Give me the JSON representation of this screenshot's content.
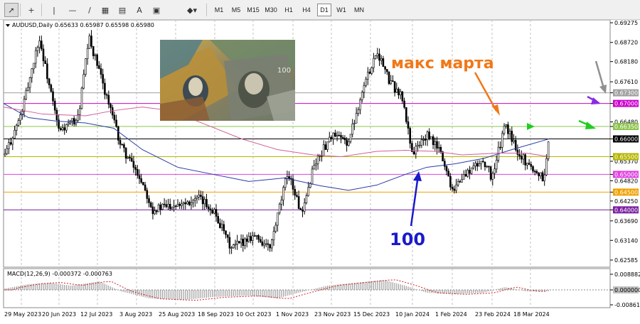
{
  "toolbar": {
    "tools": [
      {
        "name": "cursor-tool",
        "glyph": "➚"
      },
      {
        "name": "crosshair-tool",
        "glyph": "+"
      },
      {
        "name": "vertical-line-tool",
        "glyph": "|"
      },
      {
        "name": "horizontal-line-tool",
        "glyph": "—"
      },
      {
        "name": "trendline-tool",
        "glyph": "/"
      },
      {
        "name": "fibonacci-tool",
        "glyph": "▦"
      },
      {
        "name": "channel-tool",
        "glyph": "▤"
      },
      {
        "name": "text-tool",
        "glyph": "A"
      },
      {
        "name": "text-label-tool",
        "glyph": "▣"
      },
      {
        "name": "shapes-tool",
        "glyph": "◆▾"
      }
    ],
    "timeframes": [
      "M1",
      "M5",
      "M15",
      "M30",
      "H1",
      "H4",
      "D1",
      "W1",
      "MN"
    ],
    "active_timeframe": "D1"
  },
  "chart": {
    "symbol_header": "AUDUSD,Daily  0.65633 0.65987 0.65598 0.65980",
    "price_labels": [
      "0.69275",
      "0.68720",
      "0.68180",
      "0.67610",
      "0.67300",
      "0.67000",
      "0.66480",
      "0.66350",
      "0.66000",
      "0.65370",
      "0.65500",
      "0.65000",
      "0.64820",
      "0.64500",
      "0.64250",
      "0.64000",
      "0.63690",
      "0.63140",
      "0.62585"
    ],
    "highlighted_levels": [
      {
        "label": "0.67300",
        "color": "#a0a0a0"
      },
      {
        "label": "0.67000",
        "color": "#cc00cc"
      },
      {
        "label": "0.66350",
        "color": "#8bc34a"
      },
      {
        "label": "0.66000",
        "color": "#000000"
      },
      {
        "label": "0.65500",
        "color": "#b5b500"
      },
      {
        "label": "0.65000",
        "color": "#e040e0"
      },
      {
        "label": "0.64500",
        "color": "#f0a000"
      },
      {
        "label": "0.64000",
        "color": "#7b1fa2"
      }
    ],
    "date_labels": [
      "29 May 2023",
      "20 Jun 2023",
      "12 Jul 2023",
      "3 Aug 2023",
      "25 Aug 2023",
      "18 Sep 2023",
      "10 Oct 2023",
      "1 Nov 2023",
      "23 Nov 2023",
      "15 Dec 2023",
      "10 Jan 2024",
      "1 Feb 2024",
      "23 Feb 2024",
      "18 Mar 2024"
    ],
    "annotation_march_max": "макс марта",
    "annotation_ma": "100",
    "colors": {
      "annotation_orange": "#f07818",
      "annotation_blue": "#1a1acc",
      "ma_slow": "#2a3ca8",
      "ma_fast": "#d0609a",
      "candle": "#000000",
      "grid": "#c0c0c0"
    }
  },
  "macd": {
    "label": "MACD(12,26,9) -0.000372 -0.000763",
    "price_labels": [
      "0.008882",
      "0.000000",
      "-0.00861"
    ]
  }
}
